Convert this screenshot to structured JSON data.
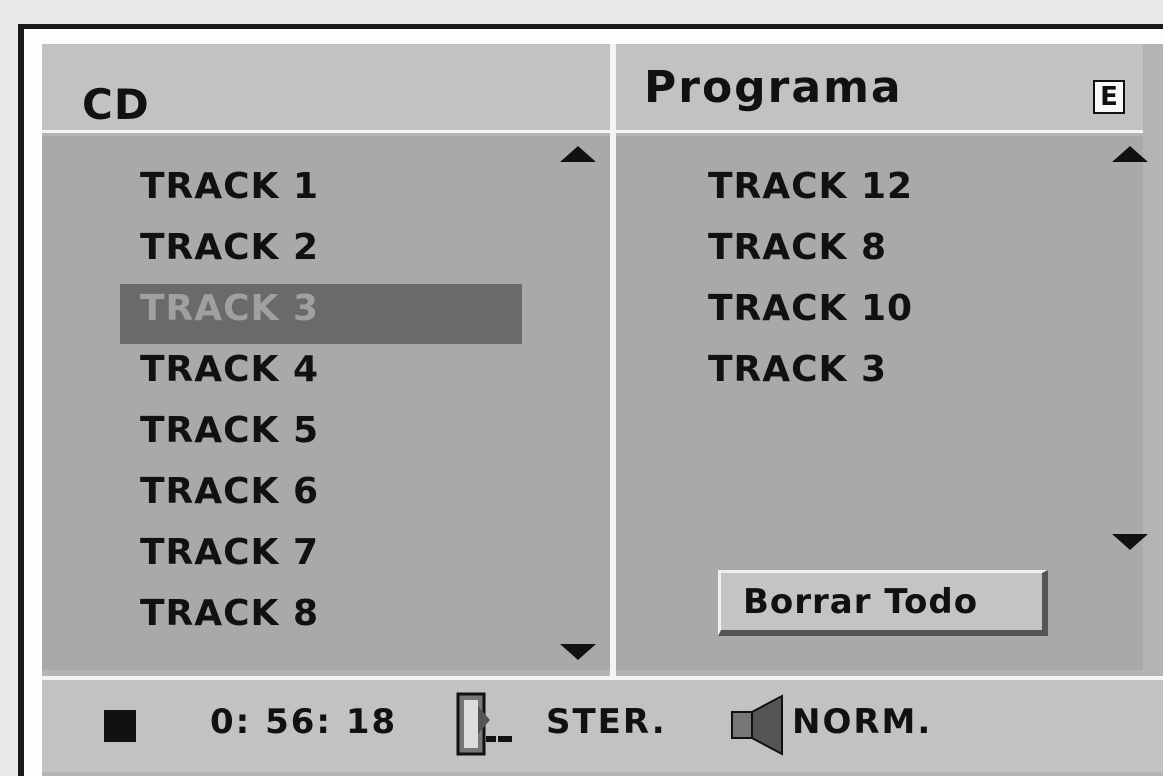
{
  "header": {
    "left_title": "CD",
    "right_title": "Programa",
    "edit_badge": "E"
  },
  "cd_list": {
    "items": [
      "TRACK 1",
      "TRACK 2",
      "TRACK 3",
      "TRACK 4",
      "TRACK 5",
      "TRACK 6",
      "TRACK 7",
      "TRACK 8"
    ],
    "selected_index": 2
  },
  "program_list": {
    "items": [
      "TRACK 12",
      "TRACK 8",
      "TRACK 10",
      "TRACK 3"
    ]
  },
  "buttons": {
    "clear_all": "Borrar Todo"
  },
  "status_bar": {
    "state_icon": "stop-icon",
    "time": "0: 56: 18",
    "audio_icon": "audio-channel-icon",
    "audio_mode": "STER.",
    "volume_icon": "speaker-icon",
    "volume_mode": "NORM."
  }
}
